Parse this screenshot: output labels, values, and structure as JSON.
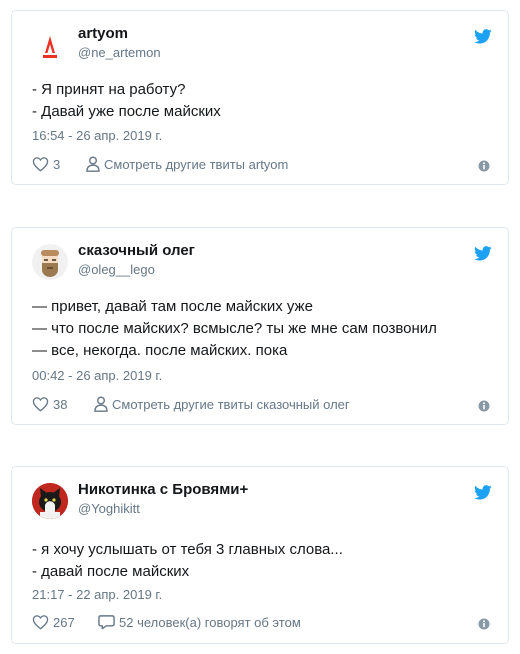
{
  "colors": {
    "twitter_blue": "#1da1f2",
    "secondary_text": "#657786",
    "border": "#e1e8ed"
  },
  "tweets": [
    {
      "author_name": "artyom",
      "handle": "@ne_artemon",
      "avatar_icon": "alfa-bank-logo",
      "lines": [
        "- Я принят на работу?",
        "- Давай уже после майских"
      ],
      "timestamp": "16:54 - 26 апр. 2019 г.",
      "likes": "3",
      "secondary_action": "Смотреть другие твиты artyom"
    },
    {
      "author_name": "сказочный олег",
      "handle": "@oleg__lego",
      "avatar_icon": "bearded-man-avatar",
      "lines": [
        "— привет, давай там после майских уже",
        "— что после майских? всмысле? ты же мне сам позвонил",
        "— все, некогда. после майских. пока"
      ],
      "timestamp": "00:42 - 26 апр. 2019 г.",
      "likes": "38",
      "secondary_action": "Смотреть другие твиты сказочный олег"
    },
    {
      "author_name": "Никотинка с Бровями+",
      "handle": "@Yoghikitt",
      "avatar_icon": "cat-photo-avatar",
      "lines": [
        "- я хочу услышать от тебя 3 главных слова...",
        "- давай после майских"
      ],
      "timestamp": "21:17 - 22 апр. 2019 г.",
      "likes": "267",
      "secondary_action": "52 человек(а) говорят об этом"
    }
  ]
}
